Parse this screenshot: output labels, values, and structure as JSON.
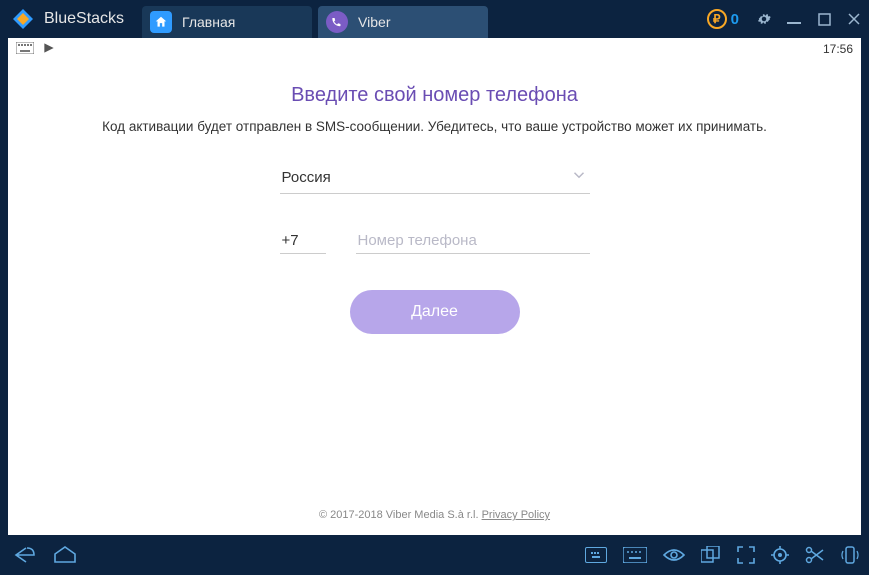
{
  "titlebar": {
    "brand": "BlueStacks",
    "tabs": [
      {
        "label": "Главная",
        "icon": "home"
      },
      {
        "label": "Viber",
        "icon": "viber"
      }
    ],
    "coins": "0"
  },
  "statusbar": {
    "time": "17:56"
  },
  "viber": {
    "title": "Введите свой номер телефона",
    "subtitle": "Код активации будет отправлен в SMS-сообщении. Убедитесь, что ваше устройство может их принимать.",
    "country": "Россия",
    "code": "+7",
    "phone_placeholder": "Номер телефона",
    "next": "Далее"
  },
  "footer": {
    "copyright": "© 2017-2018 Viber Media S.à r.l. ",
    "privacy": "Privacy Policy"
  }
}
